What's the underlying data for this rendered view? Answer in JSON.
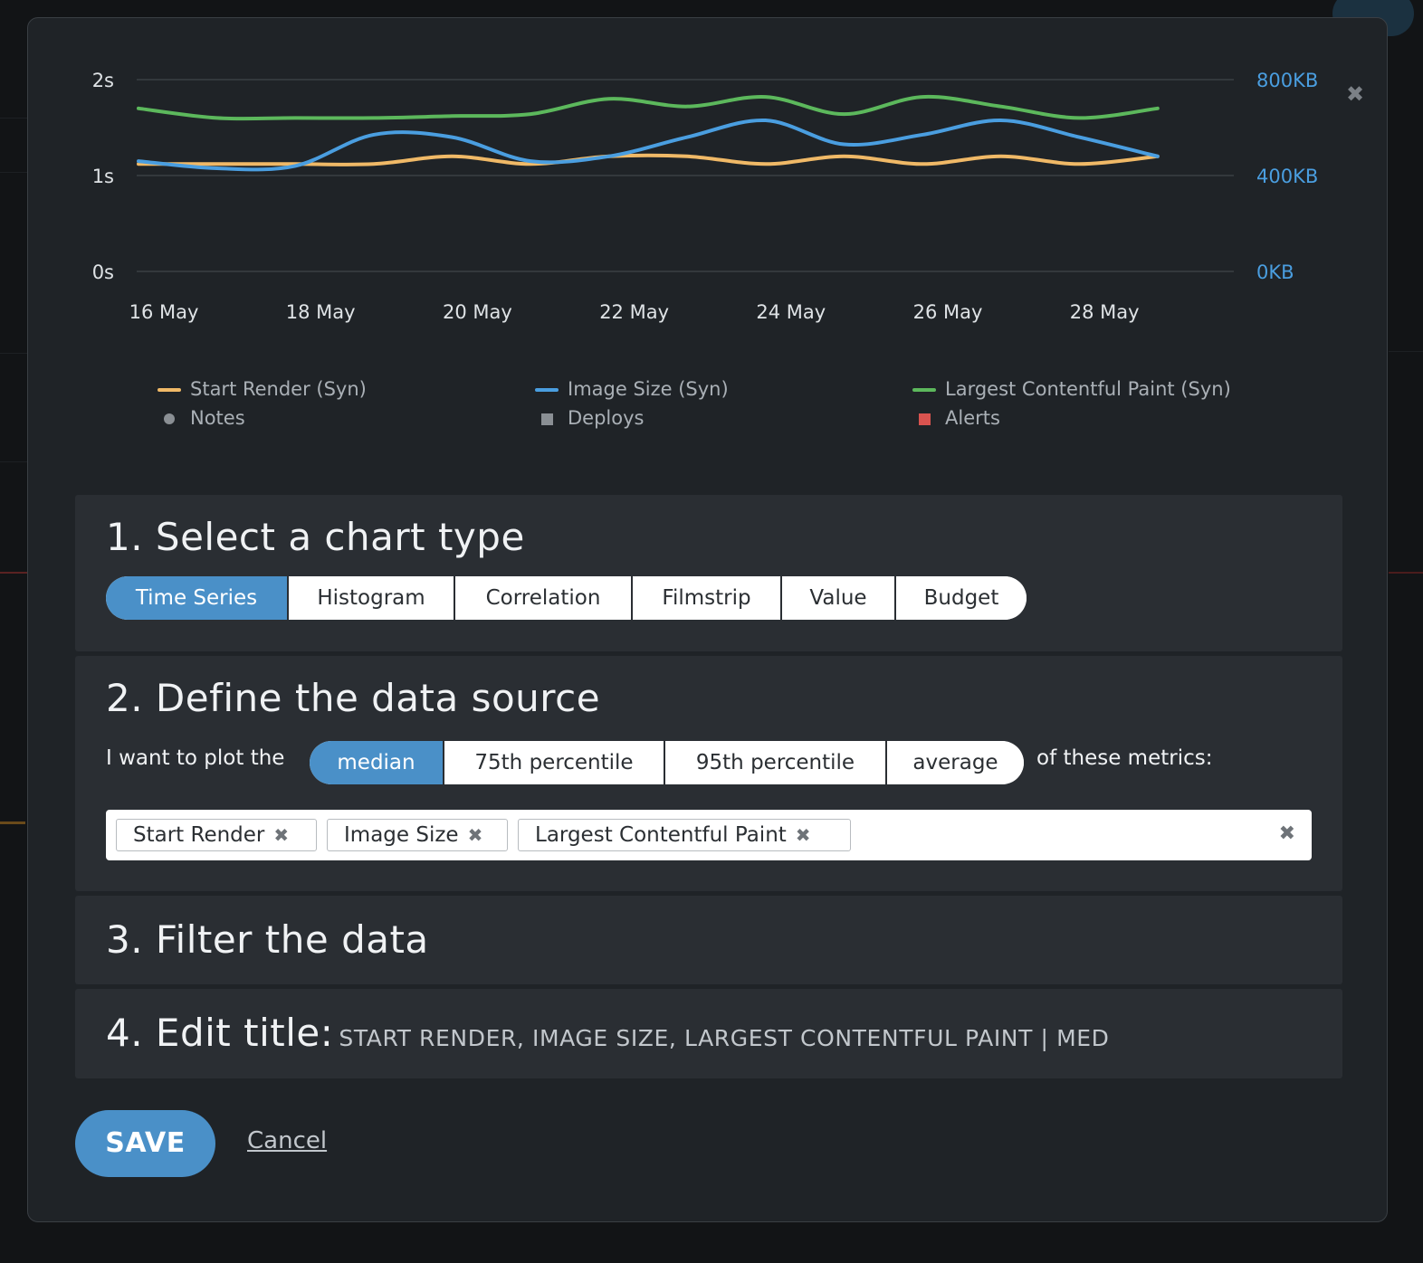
{
  "modal": {
    "close_icon": "✖"
  },
  "chart_data": {
    "type": "line",
    "x": [
      "16 May",
      "17 May",
      "18 May",
      "19 May",
      "20 May",
      "21 May",
      "22 May",
      "23 May",
      "24 May",
      "25 May",
      "26 May",
      "27 May",
      "28 May",
      "29 May"
    ],
    "x_tick_labels": [
      "16 May",
      "18 May",
      "20 May",
      "22 May",
      "24 May",
      "26 May",
      "28 May"
    ],
    "y_left": {
      "ticks": [
        "2s",
        "1s",
        "0s"
      ],
      "range": [
        0,
        2
      ]
    },
    "y_right": {
      "ticks": [
        "800KB",
        "400KB",
        "0KB"
      ],
      "range": [
        0,
        800
      ]
    },
    "grid": true,
    "series": [
      {
        "name": "Start Render (Syn)",
        "axis": "left",
        "color": "#f0b967",
        "values": [
          1.12,
          1.12,
          1.12,
          1.12,
          1.2,
          1.12,
          1.2,
          1.2,
          1.12,
          1.2,
          1.12,
          1.2,
          1.12,
          1.2
        ]
      },
      {
        "name": "Image Size (Syn)",
        "axis": "right",
        "color": "#4a9ee0",
        "values": [
          460,
          430,
          440,
          570,
          560,
          460,
          480,
          560,
          630,
          530,
          570,
          630,
          560,
          480
        ]
      },
      {
        "name": "Largest Contentful Paint (Syn)",
        "axis": "left",
        "color": "#5cb85c",
        "values": [
          1.7,
          1.6,
          1.6,
          1.6,
          1.62,
          1.64,
          1.8,
          1.72,
          1.82,
          1.64,
          1.82,
          1.72,
          1.6,
          1.7
        ]
      }
    ]
  },
  "legend": {
    "series": [
      {
        "label": "Start Render (Syn)",
        "color": "#f0b967"
      },
      {
        "label": "Image Size (Syn)",
        "color": "#4a9ee0"
      },
      {
        "label": "Largest Contentful Paint (Syn)",
        "color": "#5cb85c"
      }
    ],
    "markers": [
      {
        "label": "Notes",
        "color": "#8a8f94",
        "shape": "dot"
      },
      {
        "label": "Deploys",
        "color": "#8a8f94",
        "shape": "square"
      },
      {
        "label": "Alerts",
        "color": "#d9534f",
        "shape": "square"
      }
    ]
  },
  "step1": {
    "title": "1. Select a chart type",
    "options": [
      "Time Series",
      "Histogram",
      "Correlation",
      "Filmstrip",
      "Value",
      "Budget"
    ],
    "selected": "Time Series"
  },
  "step2": {
    "title": "2. Define the data source",
    "prefix": "I want to plot the",
    "options": [
      "median",
      "75th percentile",
      "95th percentile",
      "average"
    ],
    "selected": "median",
    "suffix": "of these metrics:",
    "metrics": [
      "Start Render",
      "Image Size",
      "Largest Contentful Paint"
    ],
    "tag_remove_icon": "✖",
    "clear_icon": "✖"
  },
  "step3": {
    "title": "3. Filter the data"
  },
  "step4": {
    "label": "4. Edit title:",
    "value": "START RENDER, IMAGE SIZE, LARGEST CONTENTFUL PAINT | MED"
  },
  "actions": {
    "save": "SAVE",
    "cancel": "Cancel"
  },
  "colors": {
    "accent": "#4a90c8",
    "panel": "#2a2e33",
    "modal": "#1f2327"
  }
}
